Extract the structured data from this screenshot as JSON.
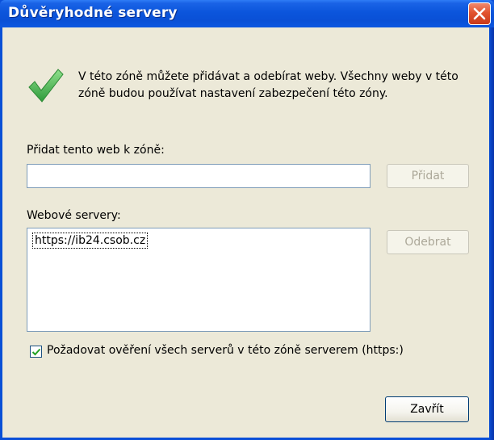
{
  "window": {
    "title": "Důvěryhodné servery"
  },
  "description": "V této zóně můžete přidávat a odebírat weby. Všechny weby v této zóně budou používat nastavení zabezpečení této zóny.",
  "add_site": {
    "label": "Přidat tento web k zóně:",
    "value": "",
    "button_label": "Přidat",
    "button_enabled": false
  },
  "websites": {
    "label": "Webové servery:",
    "items": [
      "https://ib24.csob.cz"
    ],
    "remove_button_label": "Odebrat",
    "remove_enabled": false
  },
  "require_https": {
    "label": "Požadovat ověření všech serverů v této zóně serverem (https:)",
    "checked": true
  },
  "close_button_label": "Zavřít",
  "colors": {
    "titlebar": "#0a50d6",
    "dialog_bg": "#ece9d8",
    "close": "#e2532f"
  }
}
